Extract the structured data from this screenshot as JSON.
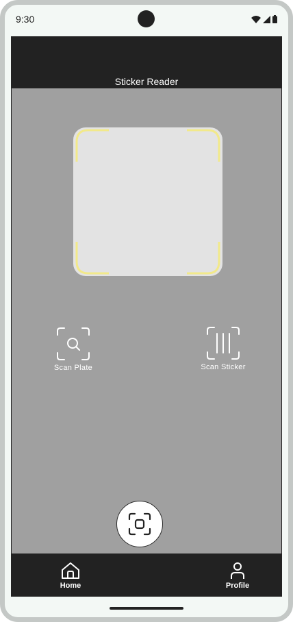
{
  "status_bar": {
    "time": "9:30"
  },
  "app_bar": {
    "title": "Sticker Reader"
  },
  "actions": {
    "scan_plate_label": "Scan Plate",
    "scan_sticker_label": "Scan Sticker"
  },
  "bottom_nav": {
    "home_label": "Home",
    "profile_label": "Profile"
  },
  "icons": {
    "wifi": "wifi-icon",
    "signal": "signal-icon",
    "battery": "battery-icon",
    "scan_plate": "scan-search-icon",
    "scan_sticker": "scan-barcode-icon",
    "home": "home-icon",
    "profile": "person-icon",
    "camera_scan": "camera-scan-icon"
  },
  "colors": {
    "app_bar": "#222222",
    "screen_bg": "#a0a0a0",
    "scan_frame_corner": "#f2e98a",
    "scan_frame_bg": "#e3e3e3"
  }
}
